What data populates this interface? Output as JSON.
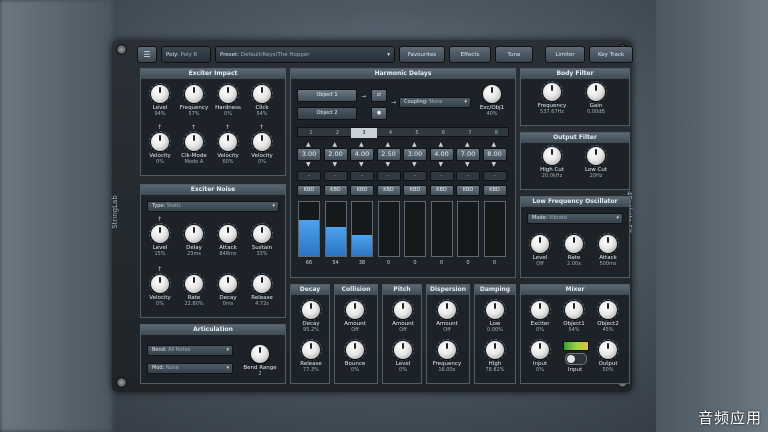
{
  "app": {
    "left_label": "StringLab",
    "right_label": "4Pockets FX"
  },
  "topbar": {
    "menu_icon": "hamburger-icon",
    "poly_label": "Poly:",
    "poly_value": "Poly 8",
    "preset_label": "Preset:",
    "preset_value": "Default/Keys/The Hopper",
    "favourites": "Favourites",
    "effects": "Effects",
    "tune": "Tune",
    "limiter": "Limiter",
    "key_track": "Key Track"
  },
  "exciter_impact": {
    "title": "Exciter Impact",
    "knobs": [
      {
        "label": "Level",
        "value": "94%"
      },
      {
        "label": "Frequency",
        "value": "57%"
      },
      {
        "label": "Hardness",
        "value": "0%"
      },
      {
        "label": "Click",
        "value": "54%"
      },
      {
        "label": "Velocity",
        "value": "0%"
      },
      {
        "label": "Clk-Mode",
        "value": "Mode A"
      },
      {
        "label": "Velocity",
        "value": "60%"
      },
      {
        "label": "Velocity",
        "value": "0%"
      }
    ]
  },
  "exciter_noise": {
    "title": "Exciter Noise",
    "type_label": "Type:",
    "type_value": "Static",
    "knobs": [
      {
        "label": "Level",
        "value": "15%"
      },
      {
        "label": "Delay",
        "value": "23ms"
      },
      {
        "label": "Attack",
        "value": "848ms"
      },
      {
        "label": "Sustain",
        "value": "33%"
      },
      {
        "label": "Velocity",
        "value": "0%"
      },
      {
        "label": "Rate",
        "value": "22.80%"
      },
      {
        "label": "Decay",
        "value": "0ms"
      },
      {
        "label": "Release",
        "value": "4.72s"
      }
    ]
  },
  "articulation": {
    "title": "Articulation",
    "bend_label": "Bend:",
    "bend_value": "All Notes",
    "mod_label": "Mod:",
    "mod_value": "None",
    "bend_range": {
      "label": "Bend Range",
      "value": "2"
    }
  },
  "harmonic_delays": {
    "title": "Harmonic Delays",
    "object1": "Object 1",
    "object2": "Object 2",
    "coupling_label": "Coupling:",
    "coupling_value": "None",
    "exc_obj": {
      "label": "Exc/Obj1",
      "value": "40%"
    },
    "tabs": [
      "1",
      "2",
      "3",
      "4",
      "5",
      "6",
      "7",
      "8"
    ],
    "selected_tab": "3",
    "ratios": [
      "3.00",
      "2.00",
      "4.00",
      "2.50",
      "3.00",
      "4.00",
      "7.00",
      "8.00"
    ],
    "kbd": "KBD",
    "levels": [
      66,
      54,
      38,
      0,
      0,
      0,
      0,
      0
    ]
  },
  "body_filter": {
    "title": "Body Filter",
    "knobs": [
      {
        "label": "Frequency",
        "value": "537.67Hz"
      },
      {
        "label": "Gain",
        "value": "0.00dB"
      }
    ]
  },
  "output_filter": {
    "title": "Output Filter",
    "knobs": [
      {
        "label": "High Cut",
        "value": "20.0kHz"
      },
      {
        "label": "Low Cut",
        "value": "20Hz"
      }
    ]
  },
  "lfo": {
    "title": "Low Frequency Oscillator",
    "mode_label": "Mode:",
    "mode_value": "Vibrato",
    "knobs": [
      {
        "label": "Level",
        "value": "Off"
      },
      {
        "label": "Rate",
        "value": "2.00x"
      },
      {
        "label": "Attack",
        "value": "500ms"
      }
    ]
  },
  "decay": {
    "title": "Decay",
    "knobs": [
      {
        "label": "Decay",
        "value": "95.2%"
      },
      {
        "label": "Release",
        "value": "77.3%"
      }
    ]
  },
  "collision": {
    "title": "Collision",
    "knobs": [
      {
        "label": "Amount",
        "value": "Off"
      },
      {
        "label": "Bounce",
        "value": "0%"
      }
    ]
  },
  "pitch": {
    "title": "Pitch",
    "knobs": [
      {
        "label": "Amount",
        "value": "Off"
      },
      {
        "label": "Level",
        "value": "0%"
      }
    ]
  },
  "dispersion": {
    "title": "Dispersion",
    "knobs": [
      {
        "label": "Amount",
        "value": "Off"
      },
      {
        "label": "Frequency",
        "value": "16.00x"
      }
    ]
  },
  "damping": {
    "title": "Damping",
    "knobs": [
      {
        "label": "Low",
        "value": "0.00%"
      },
      {
        "label": "High",
        "value": "78.82%"
      }
    ]
  },
  "mixer": {
    "title": "Mixer",
    "knobs": [
      {
        "label": "Exciter",
        "value": "0%"
      },
      {
        "label": "Object1",
        "value": "54%"
      },
      {
        "label": "Object2",
        "value": "45%"
      },
      {
        "label": "Input",
        "value": "0%"
      },
      {
        "label": "Output",
        "value": "50%"
      }
    ],
    "input_toggle": "Input"
  },
  "watermark": "音频应用"
}
